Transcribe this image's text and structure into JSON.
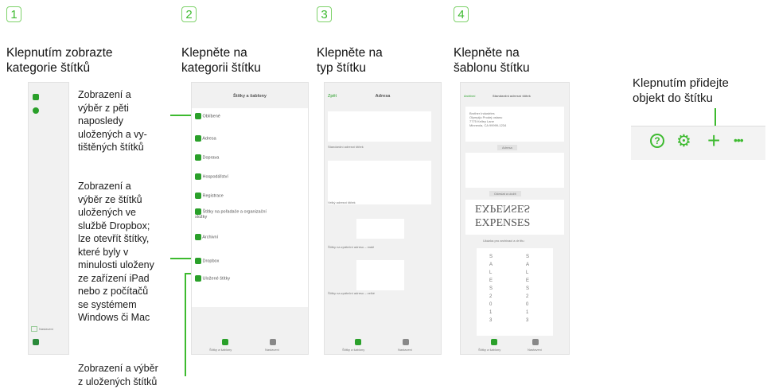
{
  "steps": [
    {
      "number": "1",
      "heading": "Klepnutím zobrazte\nkategorie štítků"
    },
    {
      "number": "2",
      "heading": "Klepněte na\nkategorii štítku"
    },
    {
      "number": "3",
      "heading": "Klepněte na\ntyp štítku"
    },
    {
      "number": "4",
      "heading": "Klepněte na\nšablonu štítku"
    }
  ],
  "annotations": {
    "recent": "Zobrazení a\nvýběr z pěti\nnaposledy\nuložených a vy-\ntištěných štítků",
    "dropbox": "Zobrazení a\nvýběr ze štítků\nuložených ve\nslužbě Dropbox;\nlze otevřít štítky,\nkteré byly v\nminulosti uloženy\nze zařízení iPad\nnebo z počítačů\nse systémem\nWindows či Mac",
    "saved": "Zobrazení a výběr\nz uložených štítků",
    "add_object": "Klepnutím přidejte\nobjekt do štítku"
  },
  "screen2": {
    "title": "Štítky a šablony",
    "items": [
      "Oblíbené",
      "Adresa",
      "Doprava",
      "Hospodářství",
      "Registrace",
      "Štítky na pořadače a organizační složky",
      "Archivní",
      "Dropbox",
      "Uložené štítky"
    ],
    "tabs": [
      "Štítky a šablony",
      "Nastavení"
    ]
  },
  "screen3": {
    "back": "Zpět",
    "title": "Adresa",
    "items": [
      "Standardní adresní štítek",
      "Velký adresní štítek",
      "Štítky na zpáteční adresu – malé",
      "Štítky na zpáteční adresu – velké"
    ],
    "tabs": [
      "Štítky a šablony",
      "Nastavení"
    ]
  },
  "screen4": {
    "back": "Archivní",
    "title": "Standardní adresní štítek",
    "sample_address": "Brother Industries\nOlympijo Prodej ostanu\n7775 Kelley Lane\nMinneola, CA 99999-1234",
    "btn1": "Adresa",
    "btn2": "Odeslat a uložit",
    "mirror_text": "EXPENSES",
    "expenses_text": "EXPENSES",
    "caption": "Ukázka pro archivaci a dr titu",
    "vertical_text": "SALES 2013",
    "tabs": [
      "Štítky a šablony",
      "Nastavení"
    ]
  },
  "toolbar": {
    "help": "?",
    "settings": "⚙",
    "add": "+",
    "more": "•••"
  },
  "screen1": {
    "bottom_label": "Nastavení"
  }
}
